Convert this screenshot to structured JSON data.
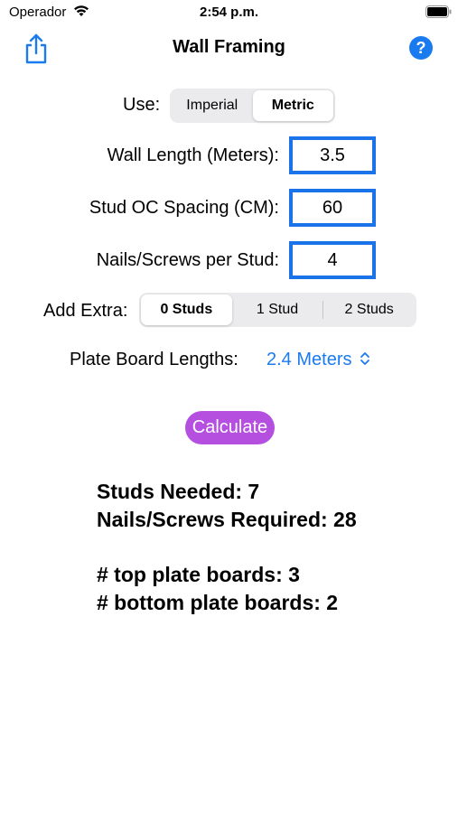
{
  "status_bar": {
    "carrier": "Operador",
    "time": "2:54 p.m."
  },
  "nav": {
    "title": "Wall Framing"
  },
  "units": {
    "label": "Use:",
    "options": [
      "Imperial",
      "Metric"
    ],
    "selected": "Metric"
  },
  "fields": {
    "wall_length": {
      "label": "Wall Length (Meters):",
      "value": "3.5"
    },
    "stud_spacing": {
      "label": "Stud OC Spacing (CM):",
      "value": "60"
    },
    "nails_per_stud": {
      "label": "Nails/Screws per Stud:",
      "value": "4"
    }
  },
  "extra": {
    "label": "Add Extra:",
    "options": [
      "0 Studs",
      "1 Stud",
      "2 Studs"
    ],
    "selected": "0 Studs"
  },
  "plate": {
    "label": "Plate Board Lengths:",
    "value": "2.4 Meters"
  },
  "calculate_label": "Calculate",
  "results": {
    "studs": "Studs Needed: 7",
    "nails": "Nails/Screws Required: 28",
    "top_plates": "# top plate boards: 3",
    "bottom_plates": "# bottom plate boards: 2"
  },
  "colors": {
    "accent": "#1a7bf1",
    "button": "#b44fdf"
  }
}
